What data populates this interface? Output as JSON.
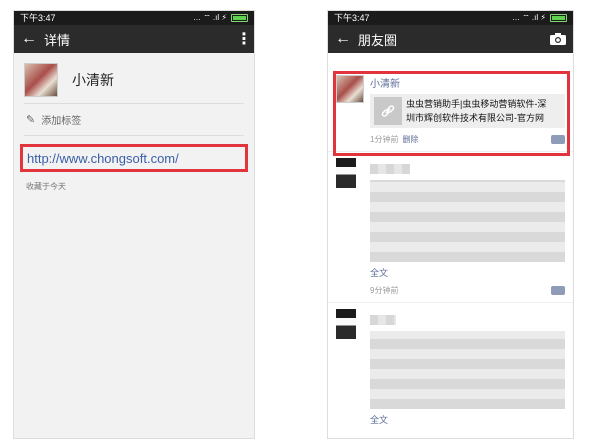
{
  "left": {
    "status": {
      "time": "下午3:47",
      "icons": "… ⌔ .ıl ⚡"
    },
    "header": {
      "title": "详情"
    },
    "profile": {
      "name": "小清新"
    },
    "tag": {
      "label": "添加标签"
    },
    "link": {
      "url": "http://www.chongsoft.com/"
    },
    "collected_note": "收藏于今天"
  },
  "right": {
    "status": {
      "time": "下午3:47",
      "icons": "… ⌔ .ıl ⚡"
    },
    "header": {
      "title": "朋友圈"
    },
    "post1": {
      "name": "小清新",
      "link_line1": "虫虫营销助手|虫虫移动营销软件-深",
      "link_line2": "圳市辉创软件技术有限公司-官方网",
      "time": "1分钟前",
      "delete": "删除"
    },
    "post2": {
      "full_text": "全文",
      "time": "9分钟前"
    },
    "post3": {
      "full_text": "全文"
    }
  },
  "colors": {
    "header_bg": "#2b2b2b",
    "highlight": "#e2343c",
    "link_blue": "#3a5fa8",
    "name_blue": "#5b6c96"
  }
}
